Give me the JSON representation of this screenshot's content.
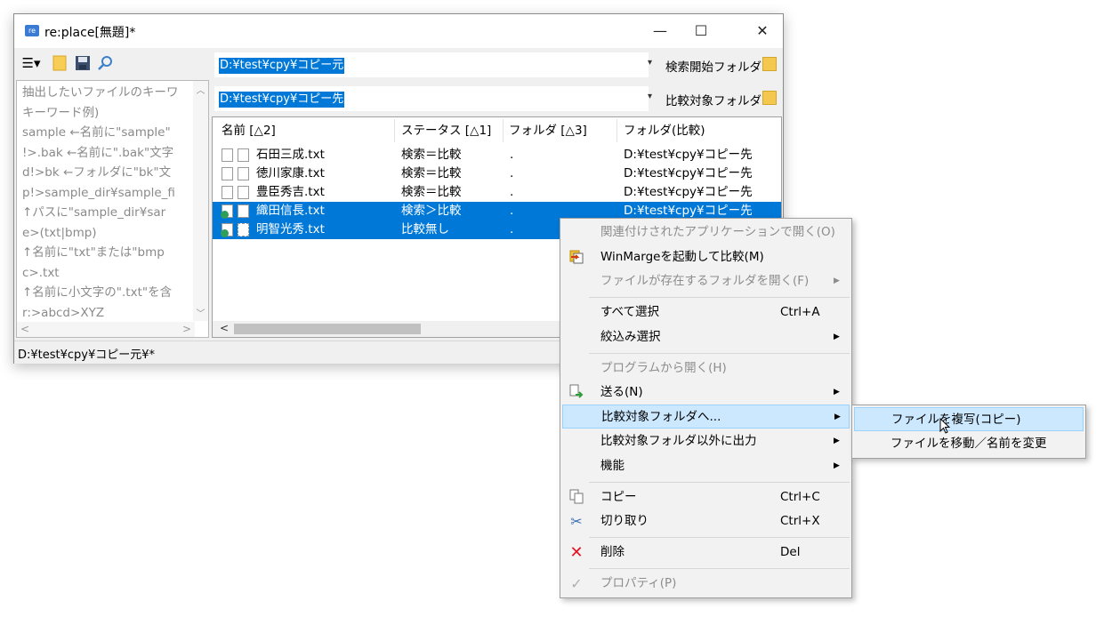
{
  "window": {
    "title": "re:place[無題]*",
    "controls": {
      "minimize": "—",
      "maximize": "☐",
      "close": "✕"
    }
  },
  "toolbar": {
    "icons": [
      "menu-icon",
      "folder-icon",
      "save-icon",
      "search-icon"
    ],
    "menu_glyph": "☰▾"
  },
  "hint_lines": [
    "抽出したいファイルのキーワ",
    "キーワード例)",
    "sample  ←名前に\"sample\"",
    "!>.bak  ←名前に\".bak\"文字",
    "d!>bk  ←フォルダに\"bk\"文",
    "p!>sample_dir¥sample_fi",
    "  ↑パスに\"sample_dir¥sar",
    "e>(txt|bmp)",
    "  ↑名前に\"txt\"または\"bmp",
    "c>.txt",
    "  ↑名前に小文字の\".txt\"を含",
    "r:>abcd>XYZ"
  ],
  "search_path": {
    "value": "D:¥test¥cpy¥コピー元",
    "label": "検索開始フォルダ"
  },
  "compare_path": {
    "value": "D:¥test¥cpy¥コピー先",
    "label": "比較対象フォルダ"
  },
  "columns": [
    "名前 [△2]",
    "ステータス [△1]",
    "フォルダ [△3]",
    "フォルダ(比較)"
  ],
  "rows": [
    {
      "name": "石田三成.txt",
      "status": "検索＝比較",
      "folder": ".",
      "compare": "D:¥test¥cpy¥コピー先"
    },
    {
      "name": "徳川家康.txt",
      "status": "検索＝比較",
      "folder": ".",
      "compare": "D:¥test¥cpy¥コピー先"
    },
    {
      "name": "豊臣秀吉.txt",
      "status": "検索＝比較",
      "folder": ".",
      "compare": "D:¥test¥cpy¥コピー先"
    },
    {
      "name": "織田信長.txt",
      "status": "検索＞比較",
      "folder": ".",
      "compare": "D:¥test¥cpy¥コピー先"
    },
    {
      "name": "明智光秀.txt",
      "status": "比較無し",
      "folder": ".",
      "compare": ""
    }
  ],
  "status_bar": "D:¥test¥cpy¥コピー元¥*",
  "context_menu": [
    {
      "label": "関連付けされたアプリケーションで開く(O)",
      "shortcut": "",
      "submenu": false,
      "disabled": true
    },
    {
      "label": "WinMargeを起動して比較(M)",
      "shortcut": "",
      "submenu": false,
      "disabled": false
    },
    {
      "label": "ファイルが存在するフォルダを開く(F)",
      "shortcut": "",
      "submenu": true,
      "disabled": true
    },
    {
      "label": "すべて選択",
      "shortcut": "Ctrl+A",
      "submenu": false,
      "disabled": false
    },
    {
      "label": "絞込み選択",
      "shortcut": "",
      "submenu": true,
      "disabled": false
    },
    {
      "label": "プログラムから開く(H)",
      "shortcut": "",
      "submenu": false,
      "disabled": true
    },
    {
      "label": "送る(N)",
      "shortcut": "",
      "submenu": true,
      "disabled": false
    },
    {
      "label": "比較対象フォルダへ...",
      "shortcut": "",
      "submenu": true,
      "disabled": false
    },
    {
      "label": "比較対象フォルダ以外に出力",
      "shortcut": "",
      "submenu": true,
      "disabled": false
    },
    {
      "label": "機能",
      "shortcut": "",
      "submenu": true,
      "disabled": false
    },
    {
      "label": "コピー",
      "shortcut": "Ctrl+C",
      "submenu": false,
      "disabled": false
    },
    {
      "label": "切り取り",
      "shortcut": "Ctrl+X",
      "submenu": false,
      "disabled": false
    },
    {
      "label": "削除",
      "shortcut": "Del",
      "submenu": false,
      "disabled": false
    },
    {
      "label": "プロパティ(P)",
      "shortcut": "",
      "submenu": false,
      "disabled": true
    }
  ],
  "submenu": [
    {
      "label": "ファイルを複写(コピー)"
    },
    {
      "label": "ファイルを移動／名前を変更"
    }
  ],
  "arrow_glyph": "▶",
  "dropdown_glyph": "▾",
  "colors": {
    "selection": "#0078d7",
    "menu_highlight": "#cce8ff",
    "delete_icon": "#e81123"
  }
}
